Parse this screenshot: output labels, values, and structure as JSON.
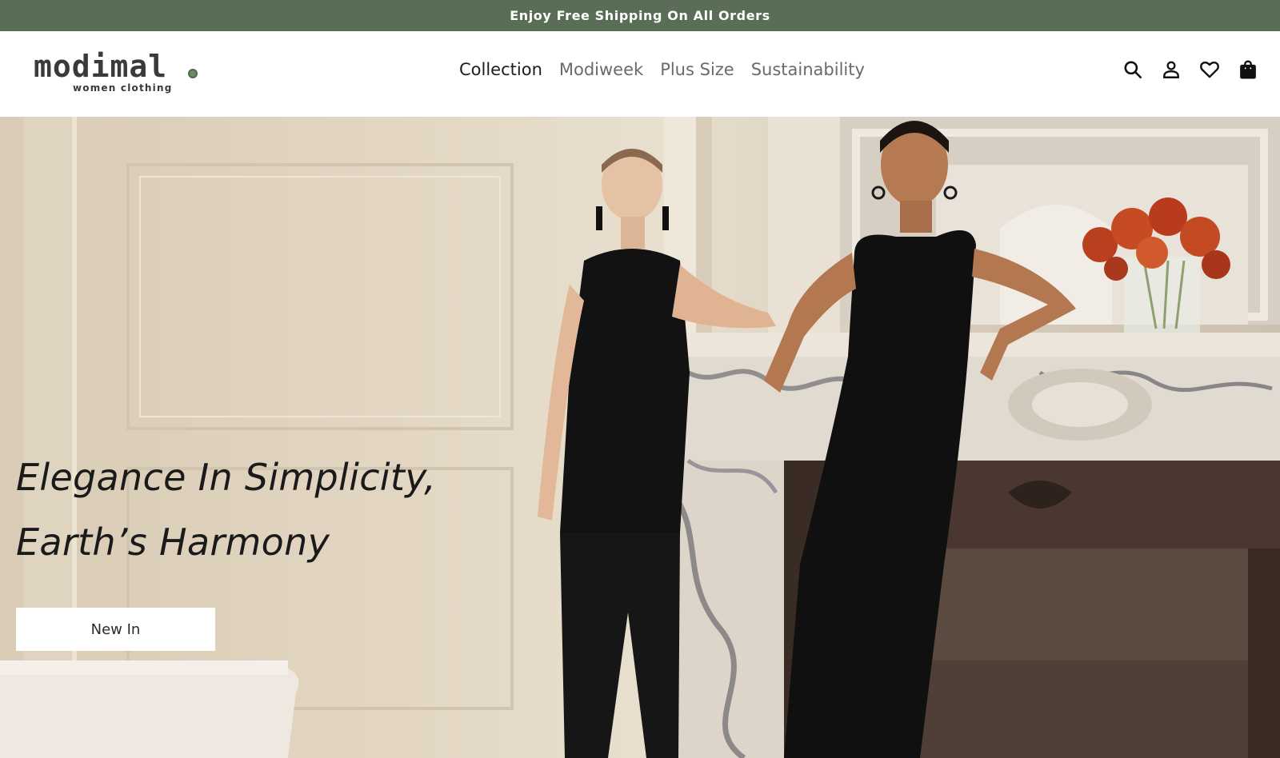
{
  "announcement": {
    "text": "Enjoy Free Shipping On All Orders"
  },
  "brand": {
    "name": "modimal",
    "tagline": "women clothing"
  },
  "nav": {
    "items": [
      {
        "label": "Collection",
        "active": true
      },
      {
        "label": "Modiweek",
        "active": false
      },
      {
        "label": "Plus Size",
        "active": false
      },
      {
        "label": "Sustainability",
        "active": false
      }
    ]
  },
  "header_icons": [
    "search-icon",
    "user-icon",
    "heart-icon",
    "shopping-bag-icon"
  ],
  "hero": {
    "headline_line1": "Elegance In Simplicity,",
    "headline_line2": "Earth’s Harmony",
    "cta_label": "New In"
  },
  "colors": {
    "announcement_bg": "#5a6e57",
    "text_dark": "#1d1d1d",
    "nav_muted": "#6a6a6a"
  }
}
